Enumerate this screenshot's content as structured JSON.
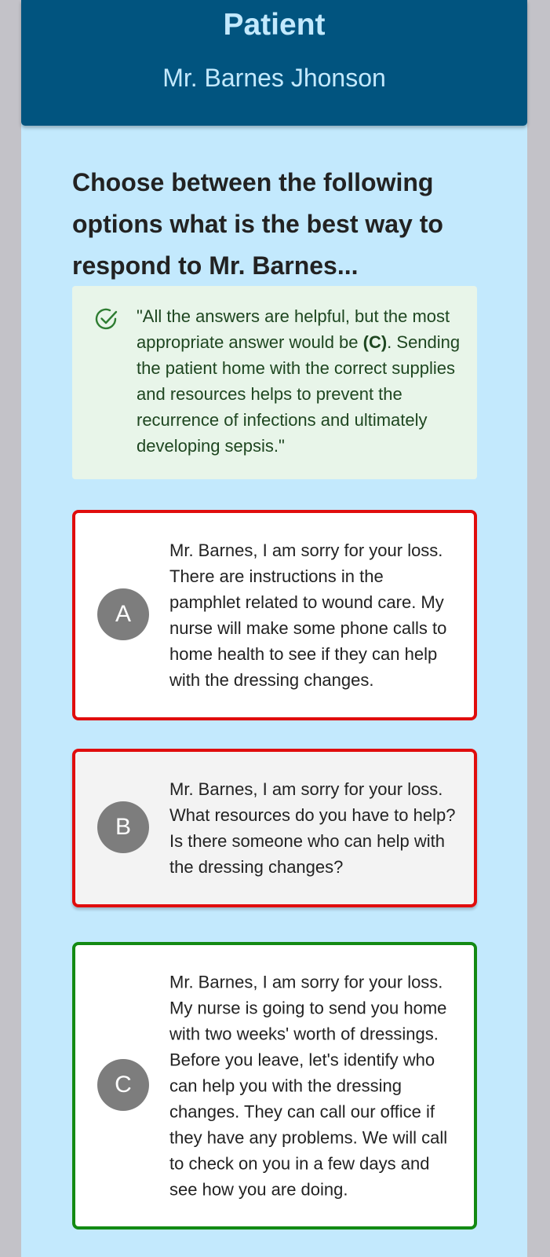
{
  "header": {
    "title": "Patient",
    "patient_name": "Mr. Barnes Jhonson"
  },
  "question": "Choose between the following options what is the best way to respond to Mr. Barnes...",
  "feedback": {
    "icon": "check-circle-icon",
    "color": "#e8f5e9",
    "text_before": "\"All the answers are helpful, but the most appropriate answer would be ",
    "text_bold": "(C)",
    "text_after": ". Sending the patient home with the correct supplies and resources helps to prevent the recurrence of infections and ultimately developing sepsis.\""
  },
  "options": [
    {
      "letter": "A",
      "status": "incorrect",
      "text": "Mr. Barnes, I am sorry for your loss. There are instructions in the pamphlet related to wound care. My nurse will make some phone calls to home health to see if they can help with the dressing changes."
    },
    {
      "letter": "B",
      "status": "incorrect-selected",
      "text": "Mr. Barnes, I am sorry for your loss. What resources do you have to help? Is there someone who can help with the dressing changes?"
    },
    {
      "letter": "C",
      "status": "correct",
      "text": "Mr. Barnes, I am sorry for your loss. My nurse is going to send you home with two weeks' worth of dressings. Before you leave, let's identify who can help you with the dressing changes. They can call our office if they have any problems. We will call to check on you in a few days and see how you are doing."
    }
  ],
  "colors": {
    "header_bg": "#01547f",
    "panel_bg": "#c3e9fd",
    "incorrect_border": "#e00d0d",
    "correct_border": "#138a13"
  }
}
